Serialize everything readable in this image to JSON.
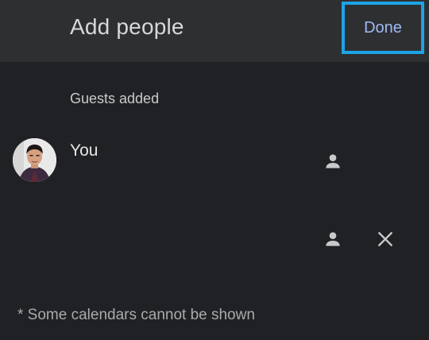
{
  "header": {
    "title": "Add people",
    "done_label": "Done"
  },
  "guests": {
    "section_label": "Guests added",
    "items": [
      {
        "name": "You",
        "avatar_icon": "user-photo-avatar",
        "role_icon": "person-icon"
      }
    ],
    "pending_row": {
      "role_icon": "person-icon",
      "remove_icon": "close-icon"
    }
  },
  "footer": {
    "note": "* Some calendars cannot be shown"
  },
  "colors": {
    "background": "#202124",
    "app_bar": "#2e2f31",
    "accent_text": "#9fb9f5",
    "focus_outline": "#1da3e6"
  }
}
